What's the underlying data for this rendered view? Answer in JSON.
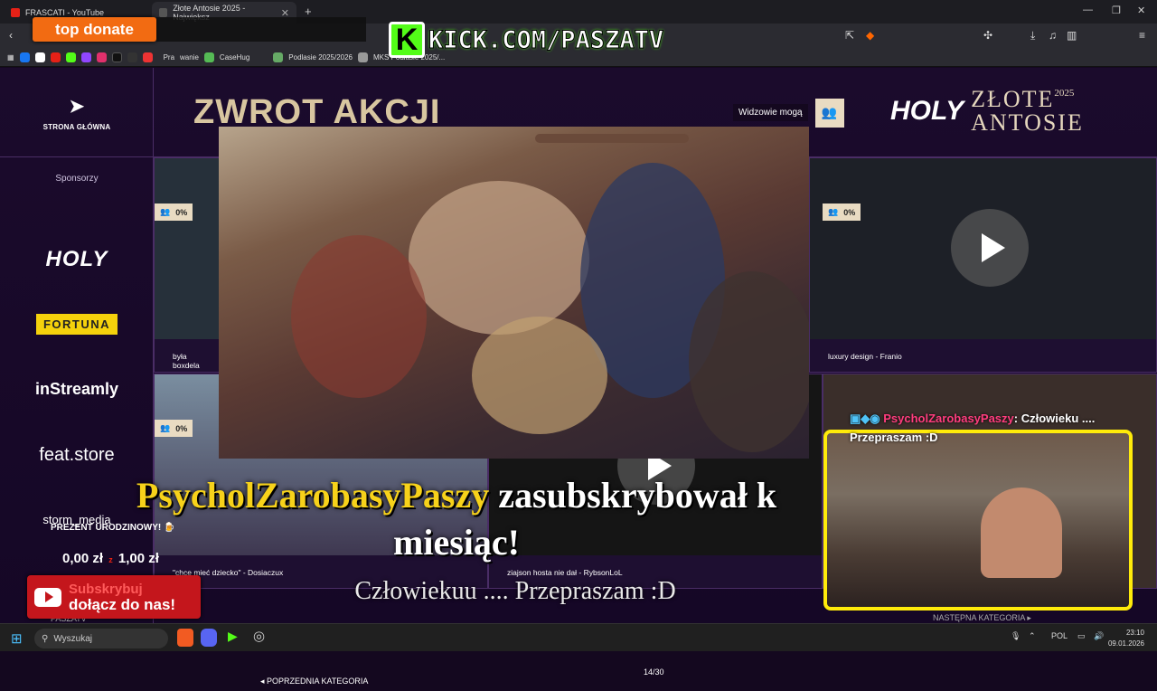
{
  "browser": {
    "tabs": [
      {
        "label": "FRASCATI - YouTube"
      },
      {
        "label": "Złote Antosie 2025 - Największ"
      }
    ],
    "new_tab": "+",
    "bookmarks": [
      "Pra",
      "wanie",
      "CaseHug",
      "Podlasie 2025/2026",
      "MKS Podlasie 2025/..."
    ]
  },
  "overlay": {
    "top_donate": "top donate",
    "kick_letter": "K",
    "kick_url": "KICK.COM/PASZATV"
  },
  "site": {
    "home_label": "STRONA GŁÓWNA",
    "sponsors_label": "Sponsorzy",
    "sponsors": [
      "HOLY",
      "FORTUNA",
      "inStreamly",
      "feat.store",
      "storm_media"
    ],
    "title": "ZWROT AKCJI",
    "viewers_label": "Widzowie mogą",
    "brand_holy": "HOLY",
    "brand_line1": "ZŁOTE",
    "brand_year": "2025",
    "brand_line2": "ANTOSIE",
    "cards": [
      {
        "caption": "była boxdela",
        "pct": "0%"
      },
      {
        "caption": "luxury design - Franio",
        "pct": "0%"
      },
      {
        "caption": "\"chce mieć dziecko\" - Dosiaczux",
        "pct": "0%"
      },
      {
        "caption": "ziajson hosta nie dał - RybsonLoL",
        "pct": ""
      }
    ],
    "prev_category": "POPRZEDNIA KATEGORIA",
    "next_category": "NASTĘPNA KATEGORIA",
    "pager": "14/30",
    "footer_user": "PASZATV"
  },
  "stream": {
    "chat_user": "PsycholZarobasyPaszy",
    "chat_text": ": Człowieku ....",
    "chat_msg": "Przepraszam :D",
    "sub_name": "PsycholZarobasyPaszy",
    "sub_text1": " zasubskrybował k",
    "sub_text2": "miesiąc!",
    "sub_message": "Człowiekuu .... Przepraszam :D",
    "gift_label": "PREZENT URODZINOWY!",
    "donation_current": "0,00 zł",
    "donation_sep": "z",
    "donation_goal": "1,00 zł",
    "yt_subscribe": "Subskrybuj",
    "yt_join": "dołącz do nas!"
  },
  "taskbar": {
    "search_placeholder": "Wyszukaj",
    "lang": "POL",
    "time": "23:10",
    "date": "09.01.2026"
  },
  "colors": {
    "accent_yellow": "#ffeb0a",
    "kick_green": "#53fc18",
    "chat_user": "#ff3c7e",
    "gold": "#d8c6a0"
  }
}
